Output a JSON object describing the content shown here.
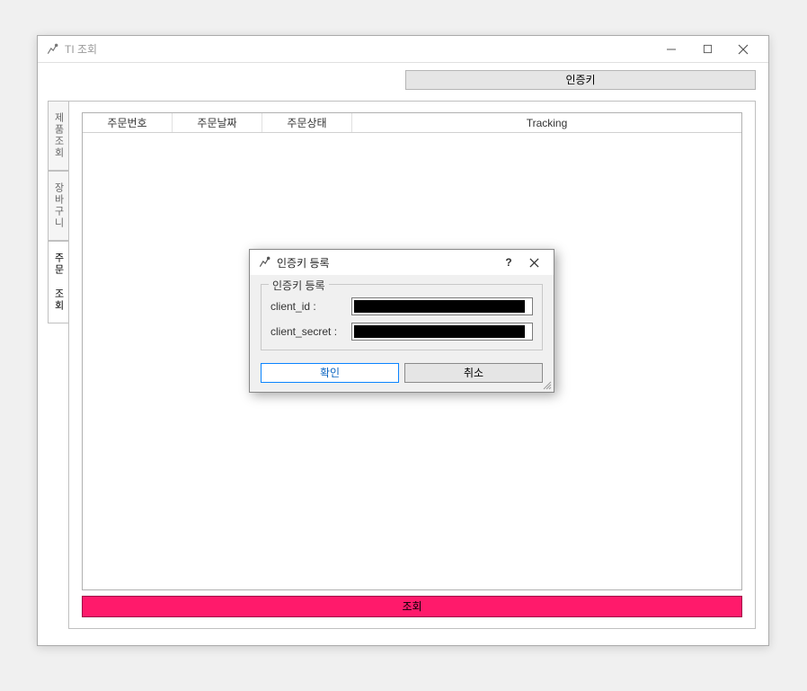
{
  "window": {
    "title": "TI 조회"
  },
  "toolbar": {
    "auth_key_label": "인증키"
  },
  "tabs": {
    "product": "제품조회",
    "cart": "장바구니",
    "order": "주문 조회"
  },
  "table": {
    "headers": {
      "order_no": "주문번호",
      "order_date": "주문날짜",
      "order_status": "주문상태",
      "tracking": "Tracking"
    }
  },
  "actions": {
    "query_label": "조회"
  },
  "dialog": {
    "title": "인증키 등록",
    "group_title": "인증키 등록",
    "client_id_label": "client_id :",
    "client_secret_label": "client_secret :",
    "client_id_value": "",
    "client_secret_value": "",
    "ok_label": "확인",
    "cancel_label": "취소"
  }
}
